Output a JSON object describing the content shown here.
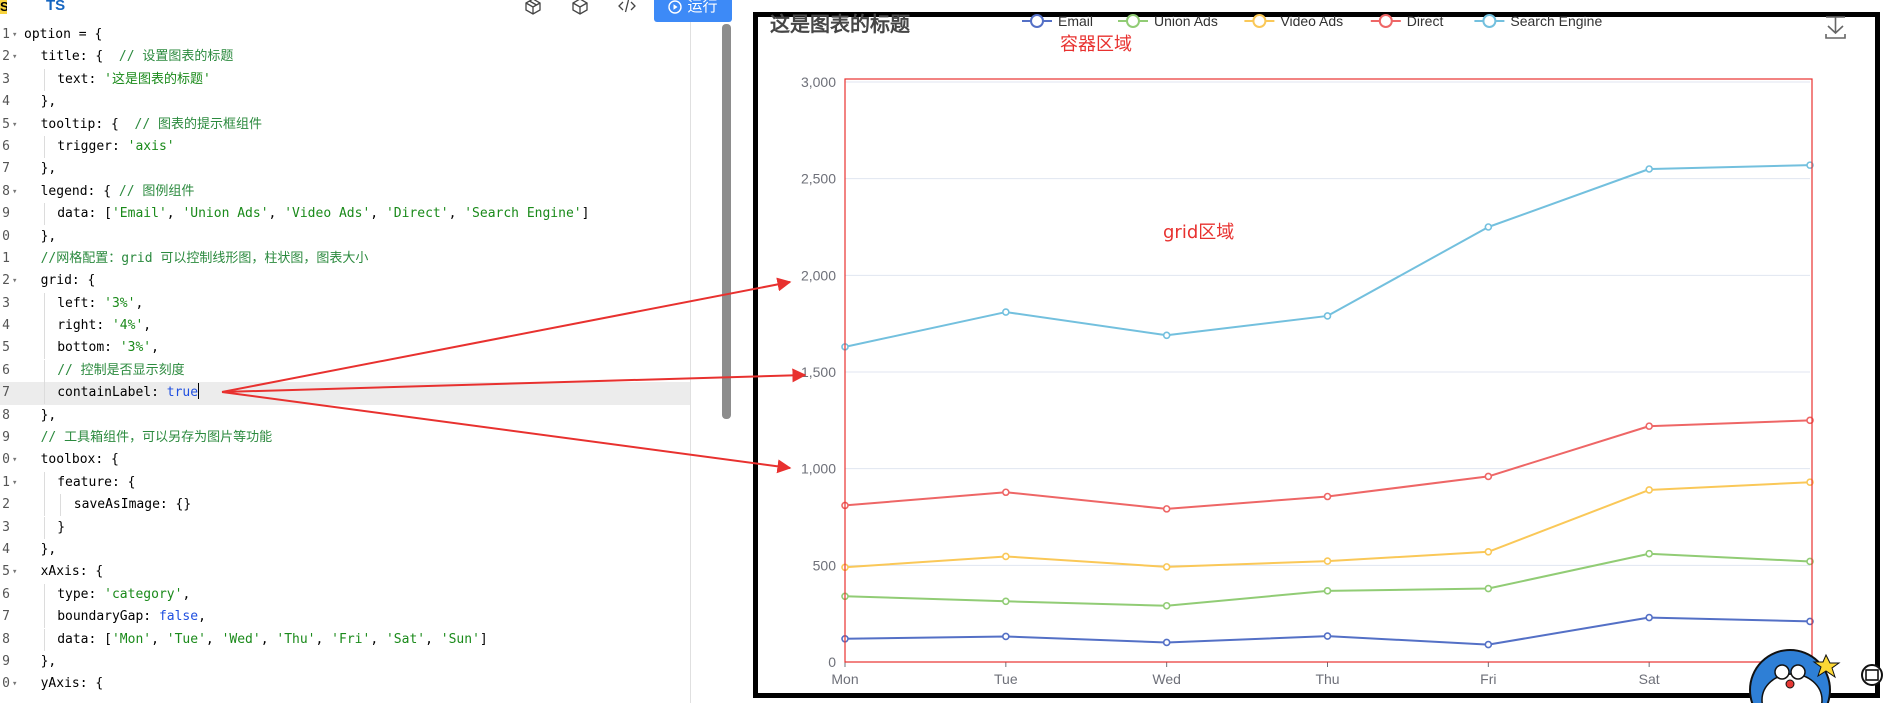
{
  "editor": {
    "language_badge": "S",
    "language_tab": "TS",
    "run_label": "运行",
    "toolbar_icons": [
      "cube-outline-icon",
      "box-icon",
      "code-icon"
    ],
    "active_line": 17,
    "lines": [
      {
        "n": "1",
        "fold": true,
        "indent": 0,
        "tokens": [
          [
            "p",
            "option = {"
          ]
        ]
      },
      {
        "n": "2",
        "fold": true,
        "indent": 1,
        "tokens": [
          [
            "p",
            "title: {  "
          ],
          [
            "c",
            "// 设置图表的标题"
          ]
        ]
      },
      {
        "n": "3",
        "fold": false,
        "indent": 2,
        "tokens": [
          [
            "p",
            "text: "
          ],
          [
            "s",
            "'这是图表的标题'"
          ]
        ]
      },
      {
        "n": "4",
        "fold": false,
        "indent": 1,
        "tokens": [
          [
            "p",
            "},"
          ]
        ]
      },
      {
        "n": "5",
        "fold": true,
        "indent": 1,
        "tokens": [
          [
            "p",
            "tooltip: {  "
          ],
          [
            "c",
            "// 图表的提示框组件"
          ]
        ]
      },
      {
        "n": "6",
        "fold": false,
        "indent": 2,
        "tokens": [
          [
            "p",
            "trigger: "
          ],
          [
            "s",
            "'axis'"
          ]
        ]
      },
      {
        "n": "7",
        "fold": false,
        "indent": 1,
        "tokens": [
          [
            "p",
            "},"
          ]
        ]
      },
      {
        "n": "8",
        "fold": true,
        "indent": 1,
        "tokens": [
          [
            "p",
            "legend: { "
          ],
          [
            "c",
            "// 图例组件"
          ]
        ]
      },
      {
        "n": "9",
        "fold": false,
        "indent": 2,
        "tokens": [
          [
            "p",
            "data: ["
          ],
          [
            "s",
            "'Email'"
          ],
          [
            "p",
            ", "
          ],
          [
            "s",
            "'Union Ads'"
          ],
          [
            "p",
            ", "
          ],
          [
            "s",
            "'Video Ads'"
          ],
          [
            "p",
            ", "
          ],
          [
            "s",
            "'Direct'"
          ],
          [
            "p",
            ", "
          ],
          [
            "s",
            "'Search Engine'"
          ],
          [
            "p",
            "]"
          ]
        ]
      },
      {
        "n": "0",
        "fold": false,
        "indent": 1,
        "tokens": [
          [
            "p",
            "},"
          ]
        ]
      },
      {
        "n": "1",
        "fold": false,
        "indent": 1,
        "tokens": [
          [
            "c",
            "//网格配置：grid 可以控制线形图，柱状图，图表大小"
          ]
        ]
      },
      {
        "n": "2",
        "fold": true,
        "indent": 1,
        "tokens": [
          [
            "p",
            "grid: {"
          ]
        ]
      },
      {
        "n": "3",
        "fold": false,
        "indent": 2,
        "tokens": [
          [
            "p",
            "left: "
          ],
          [
            "s",
            "'3%'"
          ],
          [
            "p",
            ","
          ]
        ]
      },
      {
        "n": "4",
        "fold": false,
        "indent": 2,
        "tokens": [
          [
            "p",
            "right: "
          ],
          [
            "s",
            "'4%'"
          ],
          [
            "p",
            ","
          ]
        ]
      },
      {
        "n": "5",
        "fold": false,
        "indent": 2,
        "tokens": [
          [
            "p",
            "bottom: "
          ],
          [
            "s",
            "'3%'"
          ],
          [
            "p",
            ","
          ]
        ]
      },
      {
        "n": "6",
        "fold": false,
        "indent": 2,
        "tokens": [
          [
            "c",
            "// 控制是否显示刻度"
          ]
        ]
      },
      {
        "n": "7",
        "fold": false,
        "indent": 2,
        "tokens": [
          [
            "p",
            "containLabel: "
          ],
          [
            "k",
            "true"
          ]
        ]
      },
      {
        "n": "8",
        "fold": false,
        "indent": 1,
        "tokens": [
          [
            "p",
            "},"
          ]
        ]
      },
      {
        "n": "9",
        "fold": false,
        "indent": 1,
        "tokens": [
          [
            "c",
            "// 工具箱组件，可以另存为图片等功能"
          ]
        ]
      },
      {
        "n": "0",
        "fold": true,
        "indent": 1,
        "tokens": [
          [
            "p",
            "toolbox: {"
          ]
        ]
      },
      {
        "n": "1",
        "fold": true,
        "indent": 2,
        "tokens": [
          [
            "p",
            "feature: {"
          ]
        ]
      },
      {
        "n": "2",
        "fold": false,
        "indent": 3,
        "tokens": [
          [
            "p",
            "saveAsImage: {}"
          ]
        ]
      },
      {
        "n": "3",
        "fold": false,
        "indent": 2,
        "tokens": [
          [
            "p",
            "}"
          ]
        ]
      },
      {
        "n": "4",
        "fold": false,
        "indent": 1,
        "tokens": [
          [
            "p",
            "},"
          ]
        ]
      },
      {
        "n": "5",
        "fold": true,
        "indent": 1,
        "tokens": [
          [
            "p",
            "xAxis: {"
          ]
        ]
      },
      {
        "n": "6",
        "fold": false,
        "indent": 2,
        "tokens": [
          [
            "p",
            "type: "
          ],
          [
            "s",
            "'category'"
          ],
          [
            "p",
            ","
          ]
        ]
      },
      {
        "n": "7",
        "fold": false,
        "indent": 2,
        "tokens": [
          [
            "p",
            "boundaryGap: "
          ],
          [
            "k",
            "false"
          ],
          [
            "p",
            ","
          ]
        ]
      },
      {
        "n": "8",
        "fold": false,
        "indent": 2,
        "tokens": [
          [
            "p",
            "data: ["
          ],
          [
            "s",
            "'Mon'"
          ],
          [
            "p",
            ", "
          ],
          [
            "s",
            "'Tue'"
          ],
          [
            "p",
            ", "
          ],
          [
            "s",
            "'Wed'"
          ],
          [
            "p",
            ", "
          ],
          [
            "s",
            "'Thu'"
          ],
          [
            "p",
            ", "
          ],
          [
            "s",
            "'Fri'"
          ],
          [
            "p",
            ", "
          ],
          [
            "s",
            "'Sat'"
          ],
          [
            "p",
            ", "
          ],
          [
            "s",
            "'Sun'"
          ],
          [
            "p",
            "]"
          ]
        ]
      },
      {
        "n": "9",
        "fold": false,
        "indent": 1,
        "tokens": [
          [
            "p",
            "},"
          ]
        ]
      },
      {
        "n": "0",
        "fold": true,
        "indent": 1,
        "tokens": [
          [
            "p",
            "yAxis: {"
          ]
        ]
      }
    ]
  },
  "annotations": {
    "container_label": "容器区域",
    "grid_label": "grid区域",
    "color": "#e8312f"
  },
  "chart_data": {
    "type": "line",
    "title": "这是图表的标题",
    "categories": [
      "Mon",
      "Tue",
      "Wed",
      "Thu",
      "Fri",
      "Sat",
      "Sun"
    ],
    "visible_categories": [
      "Mon",
      "Tue",
      "Wed",
      "Thu",
      "Fri",
      "Sat"
    ],
    "ylim": [
      0,
      3000
    ],
    "yticks": [
      0,
      500,
      1000,
      1500,
      2000,
      2500,
      3000
    ],
    "ytick_labels": [
      "0",
      "500",
      "1,000",
      "1,500",
      "2,000",
      "2,500",
      "3,000"
    ],
    "grid": true,
    "legend_position": "top",
    "series": [
      {
        "name": "Email",
        "color": "#5470c6",
        "values": [
          120,
          132,
          101,
          134,
          90,
          230,
          210
        ]
      },
      {
        "name": "Union Ads",
        "color": "#91cc75",
        "values": [
          340,
          314,
          291,
          368,
          380,
          560,
          520
        ]
      },
      {
        "name": "Video Ads",
        "color": "#fac858",
        "values": [
          490,
          546,
          492,
          522,
          570,
          890,
          930
        ]
      },
      {
        "name": "Direct",
        "color": "#ee6666",
        "values": [
          810,
          878,
          792,
          856,
          960,
          1220,
          1250
        ]
      },
      {
        "name": "Search Engine",
        "color": "#73c0de",
        "values": [
          1630,
          1810,
          1690,
          1790,
          2250,
          2550,
          2570
        ]
      }
    ],
    "toolbox_icon": "download-icon"
  }
}
